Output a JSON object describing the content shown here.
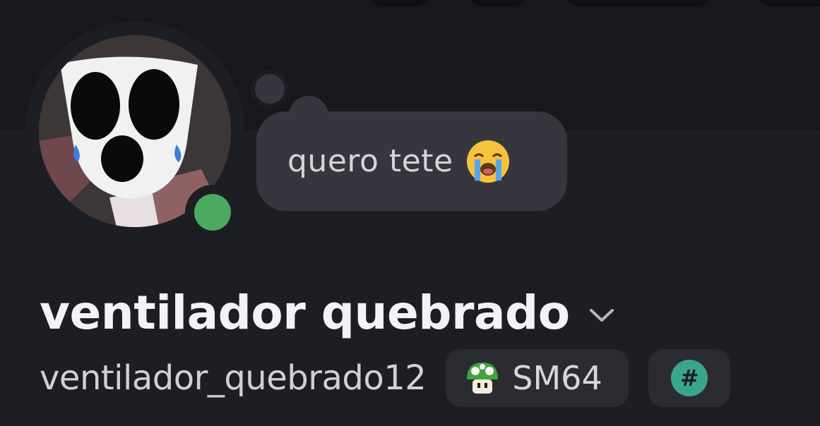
{
  "profile": {
    "status_text": "quero tete",
    "status_emoji": "loudly-crying-face-icon",
    "display_name": "ventilador quebrado",
    "username": "ventilador_quebrado12",
    "online_status": "online",
    "online_color": "#4ca960"
  },
  "tags": [
    {
      "icon": "mushroom-icon",
      "label": "SM64"
    },
    {
      "icon": "hash-icon",
      "label": "#"
    }
  ],
  "colors": {
    "background": "#1d1e23",
    "banner": "#17181c",
    "bubble": "#36373e",
    "pill": "#2b2c32",
    "hash_badge": "#3ba58c"
  }
}
